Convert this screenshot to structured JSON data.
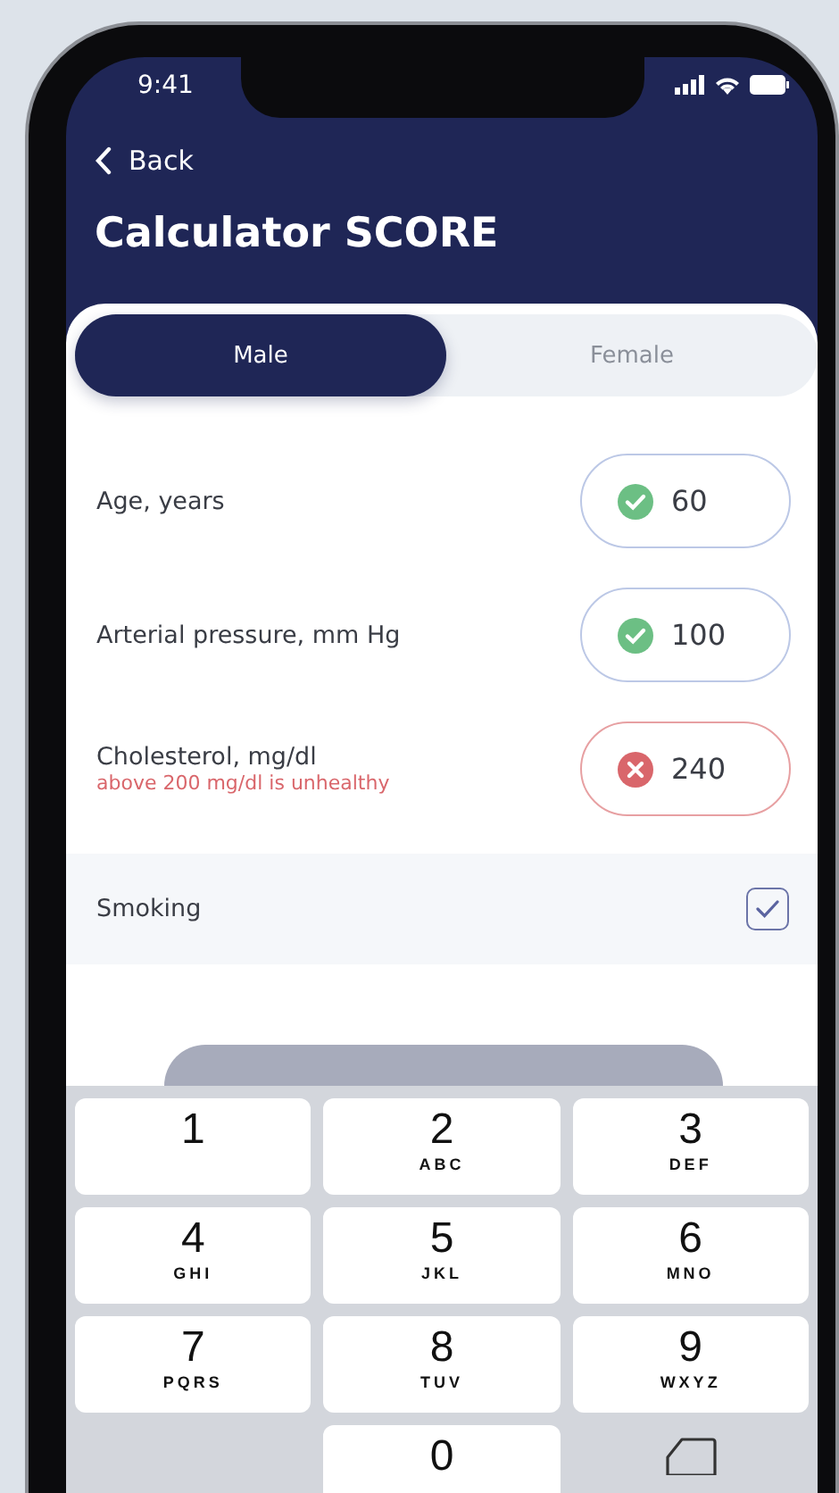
{
  "status_bar": {
    "time": "9:41"
  },
  "nav": {
    "back": "Back",
    "title": "Calculator SCORE"
  },
  "sex_tabs": [
    {
      "label": "Male",
      "selected": true
    },
    {
      "label": "Female",
      "selected": false
    }
  ],
  "fields": [
    {
      "label": "Age, years",
      "value": "60",
      "valid": true
    },
    {
      "label": "Arterial pressure, mm Hg",
      "value": "100",
      "valid": true
    },
    {
      "label": "Cholesterol, mg/dl",
      "value": "240",
      "valid": false,
      "hint": "above 200 mg/dl is unhealthy"
    }
  ],
  "smoking": {
    "label": "Smoking",
    "checked": true
  },
  "keypad": [
    {
      "digit": "1"
    },
    {
      "digit": "2",
      "letters": "ABC"
    },
    {
      "digit": "3",
      "letters": "DEF"
    },
    {
      "digit": "4",
      "letters": "GHI"
    },
    {
      "digit": "5",
      "letters": "JKL"
    },
    {
      "digit": "6",
      "letters": "MNO"
    },
    {
      "digit": "7",
      "letters": "PQRS"
    },
    {
      "digit": "8",
      "letters": "TUV"
    },
    {
      "digit": "9",
      "letters": "WXYZ"
    },
    {
      "digit": "0"
    }
  ]
}
